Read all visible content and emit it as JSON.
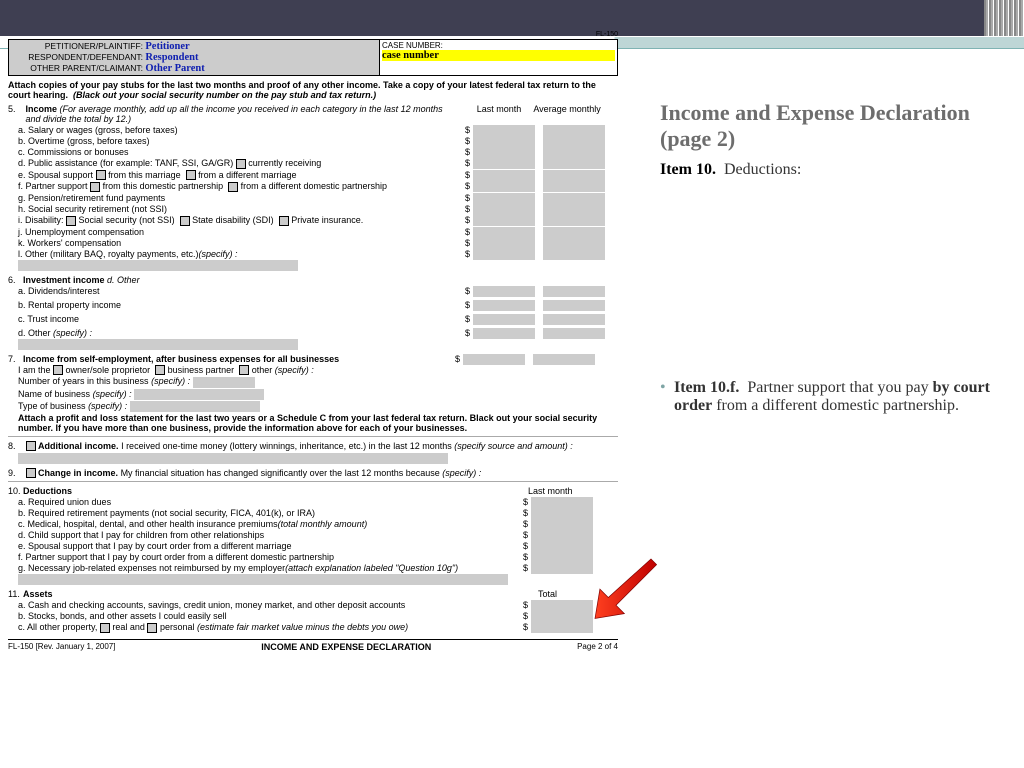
{
  "right": {
    "title": "Income and Expense Declaration (page 2)",
    "sub_b": "Item 10.",
    "sub_t": "Deductions:",
    "bullet_b1": "Item 10.f.",
    "bullet_t1": "Partner support that you pay",
    "bullet_b2": "by court order",
    "bullet_t2": "from a different domestic partnership."
  },
  "case": {
    "l1": "PETITIONER/PLAINTIFF:",
    "v1": "Petitioner",
    "l2": "RESPONDENT/DEFENDANT:",
    "v2": "Respondent",
    "l3": "OTHER PARENT/CLAIMANT:",
    "v3": "Other Parent",
    "cn_label": "CASE NUMBER:",
    "cn": "case number"
  },
  "form_id": "FL-150",
  "instr1": "Attach copies of your pay stubs for the last two months and proof of any other income. Take a copy of your latest federal tax return to the court hearing.",
  "instr2": "(Black out your social security number on the pay stub and tax return.)",
  "col_lm": "Last month",
  "col_am": "Average monthly",
  "s5": {
    "n": "5.",
    "t": "Income",
    "d": "(For average monthly, add up all the income you received in each category in the last 12 months and divide the total by 12.)",
    "a": "a.  Salary or wages (gross, before taxes)",
    "b": "b.  Overtime (gross, before taxes)",
    "c": "c.  Commissions or bonuses",
    "d1": "d.  Public assistance (for example: TANF, SSI, GA/GR)",
    "d2": "currently receiving",
    "e1": "e.  Spousal support",
    "e2": "from this marriage",
    "e3": "from a different marriage",
    "f1": "f.   Partner support",
    "f2": "from this domestic partnership",
    "f3": "from a different domestic partnership",
    "g": "g.  Pension/retirement fund payments",
    "h": "h.  Social security retirement (not SSI)",
    "i1": "i.   Disability:",
    "i2": "Social security (not SSI)",
    "i3": "State disability (SDI)",
    "i4": "Private insurance.",
    "j": "j.   Unemployment compensation",
    "k": "k.  Workers' compensation",
    "l": "l.   Other (military BAQ, royalty payments, etc.)",
    "ls": "(specify) :"
  },
  "s6": {
    "n": "6.",
    "t": "Investment income",
    "d": "d.  Other",
    "a": "a.  Dividends/interest",
    "b": "b.  Rental property income",
    "c": "c.  Trust income",
    "ds": "(specify) :"
  },
  "s7": {
    "n": "7.",
    "t": "Income from self-employment, after business expenses for all businesses",
    "a": "I am the",
    "a1": "owner/sole proprietor",
    "a2": "business partner",
    "a3": "other",
    "as": "(specify) :",
    "b": "Number of years in this business",
    "bs": "(specify) :",
    "c": "Name of business",
    "cs": "(specify) :",
    "d": "Type of business",
    "ds": "(specify) :",
    "e": "Attach a profit and loss statement for the last two years or a Schedule C from your last federal tax return. Black out your social security number. If you have more than one business, provide the information above for each of your businesses."
  },
  "s8": {
    "n": "8.",
    "t": "Additional income.",
    "d": "I received one-time money (lottery winnings, inheritance, etc.) in the last 12 months",
    "ds": "(specify source and amount) :"
  },
  "s9": {
    "n": "9.",
    "t": "Change in income.",
    "d": "My financial situation has changed significantly over the last 12 months because",
    "ds": "(specify) :"
  },
  "s10": {
    "n": "10.",
    "t": "Deductions",
    "col": "Last month",
    "a": "a.  Required union dues",
    "b": "b.  Required retirement payments (not social security, FICA, 401(k), or IRA)",
    "c": "c.  Medical, hospital, dental, and other health insurance premiums",
    "cs": "(total monthly amount)",
    "d": "d.  Child support that I pay for children from other relationships",
    "e": "e.  Spousal support that I pay by court order from a different marriage",
    "f": "f.   Partner support that I pay by court order from a different domestic partnership",
    "g": "g.  Necessary job-related expenses not reimbursed by my employer",
    "gs": "(attach explanation labeled \"Question 10g\")"
  },
  "s11": {
    "n": "11.",
    "t": "Assets",
    "col": "Total",
    "a": "a.  Cash and checking accounts, savings, credit union, money market, and other deposit accounts",
    "b": "b.  Stocks, bonds, and other assets I could easily sell",
    "c": "c.  All other property,",
    "c1": "real and",
    "c2": "personal",
    "cs": "(estimate fair market value minus the debts you owe)"
  },
  "foot": {
    "l": "FL-150 [Rev. January 1, 2007]",
    "c": "INCOME AND EXPENSE DECLARATION",
    "r": "Page 2 of 4"
  }
}
